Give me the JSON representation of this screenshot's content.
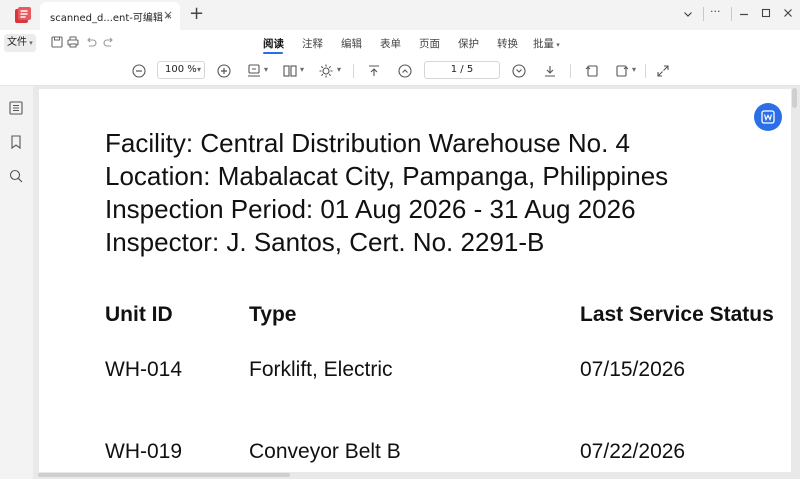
{
  "titlebar": {
    "tab_title": "scanned_d...ent-可编辑 *",
    "tab_close": "×",
    "new_tab": "+",
    "more": "···"
  },
  "menubar": {
    "file": "文件",
    "items": [
      "阅读",
      "注释",
      "编辑",
      "表单",
      "页面",
      "保护",
      "转换",
      "批量"
    ],
    "active_index": 0
  },
  "toolbar": {
    "zoom": "100 %",
    "page_indicator": "1 / 5"
  },
  "document": {
    "header_lines": [
      "Facility: Central Distribution Warehouse No. 4",
      "Location: Mabalacat City, Pampanga, Philippines",
      "Inspection Period: 01 Aug 2026 - 31 Aug 2026",
      "Inspector: J. Santos, Cert. No. 2291-B"
    ],
    "table": {
      "columns": [
        "Unit ID",
        "Type",
        "Last Service Status"
      ],
      "rows": [
        [
          "WH-014",
          "Forklift, Electric",
          "07/15/2026"
        ],
        [
          "WH-019",
          "Conveyor Belt B",
          "07/22/2026"
        ]
      ]
    }
  },
  "colors": {
    "accent": "#2a6ee8",
    "app_logo": "#d9363e"
  },
  "icons": {
    "app": "pdf-app-icon",
    "float": "word-convert-icon"
  }
}
